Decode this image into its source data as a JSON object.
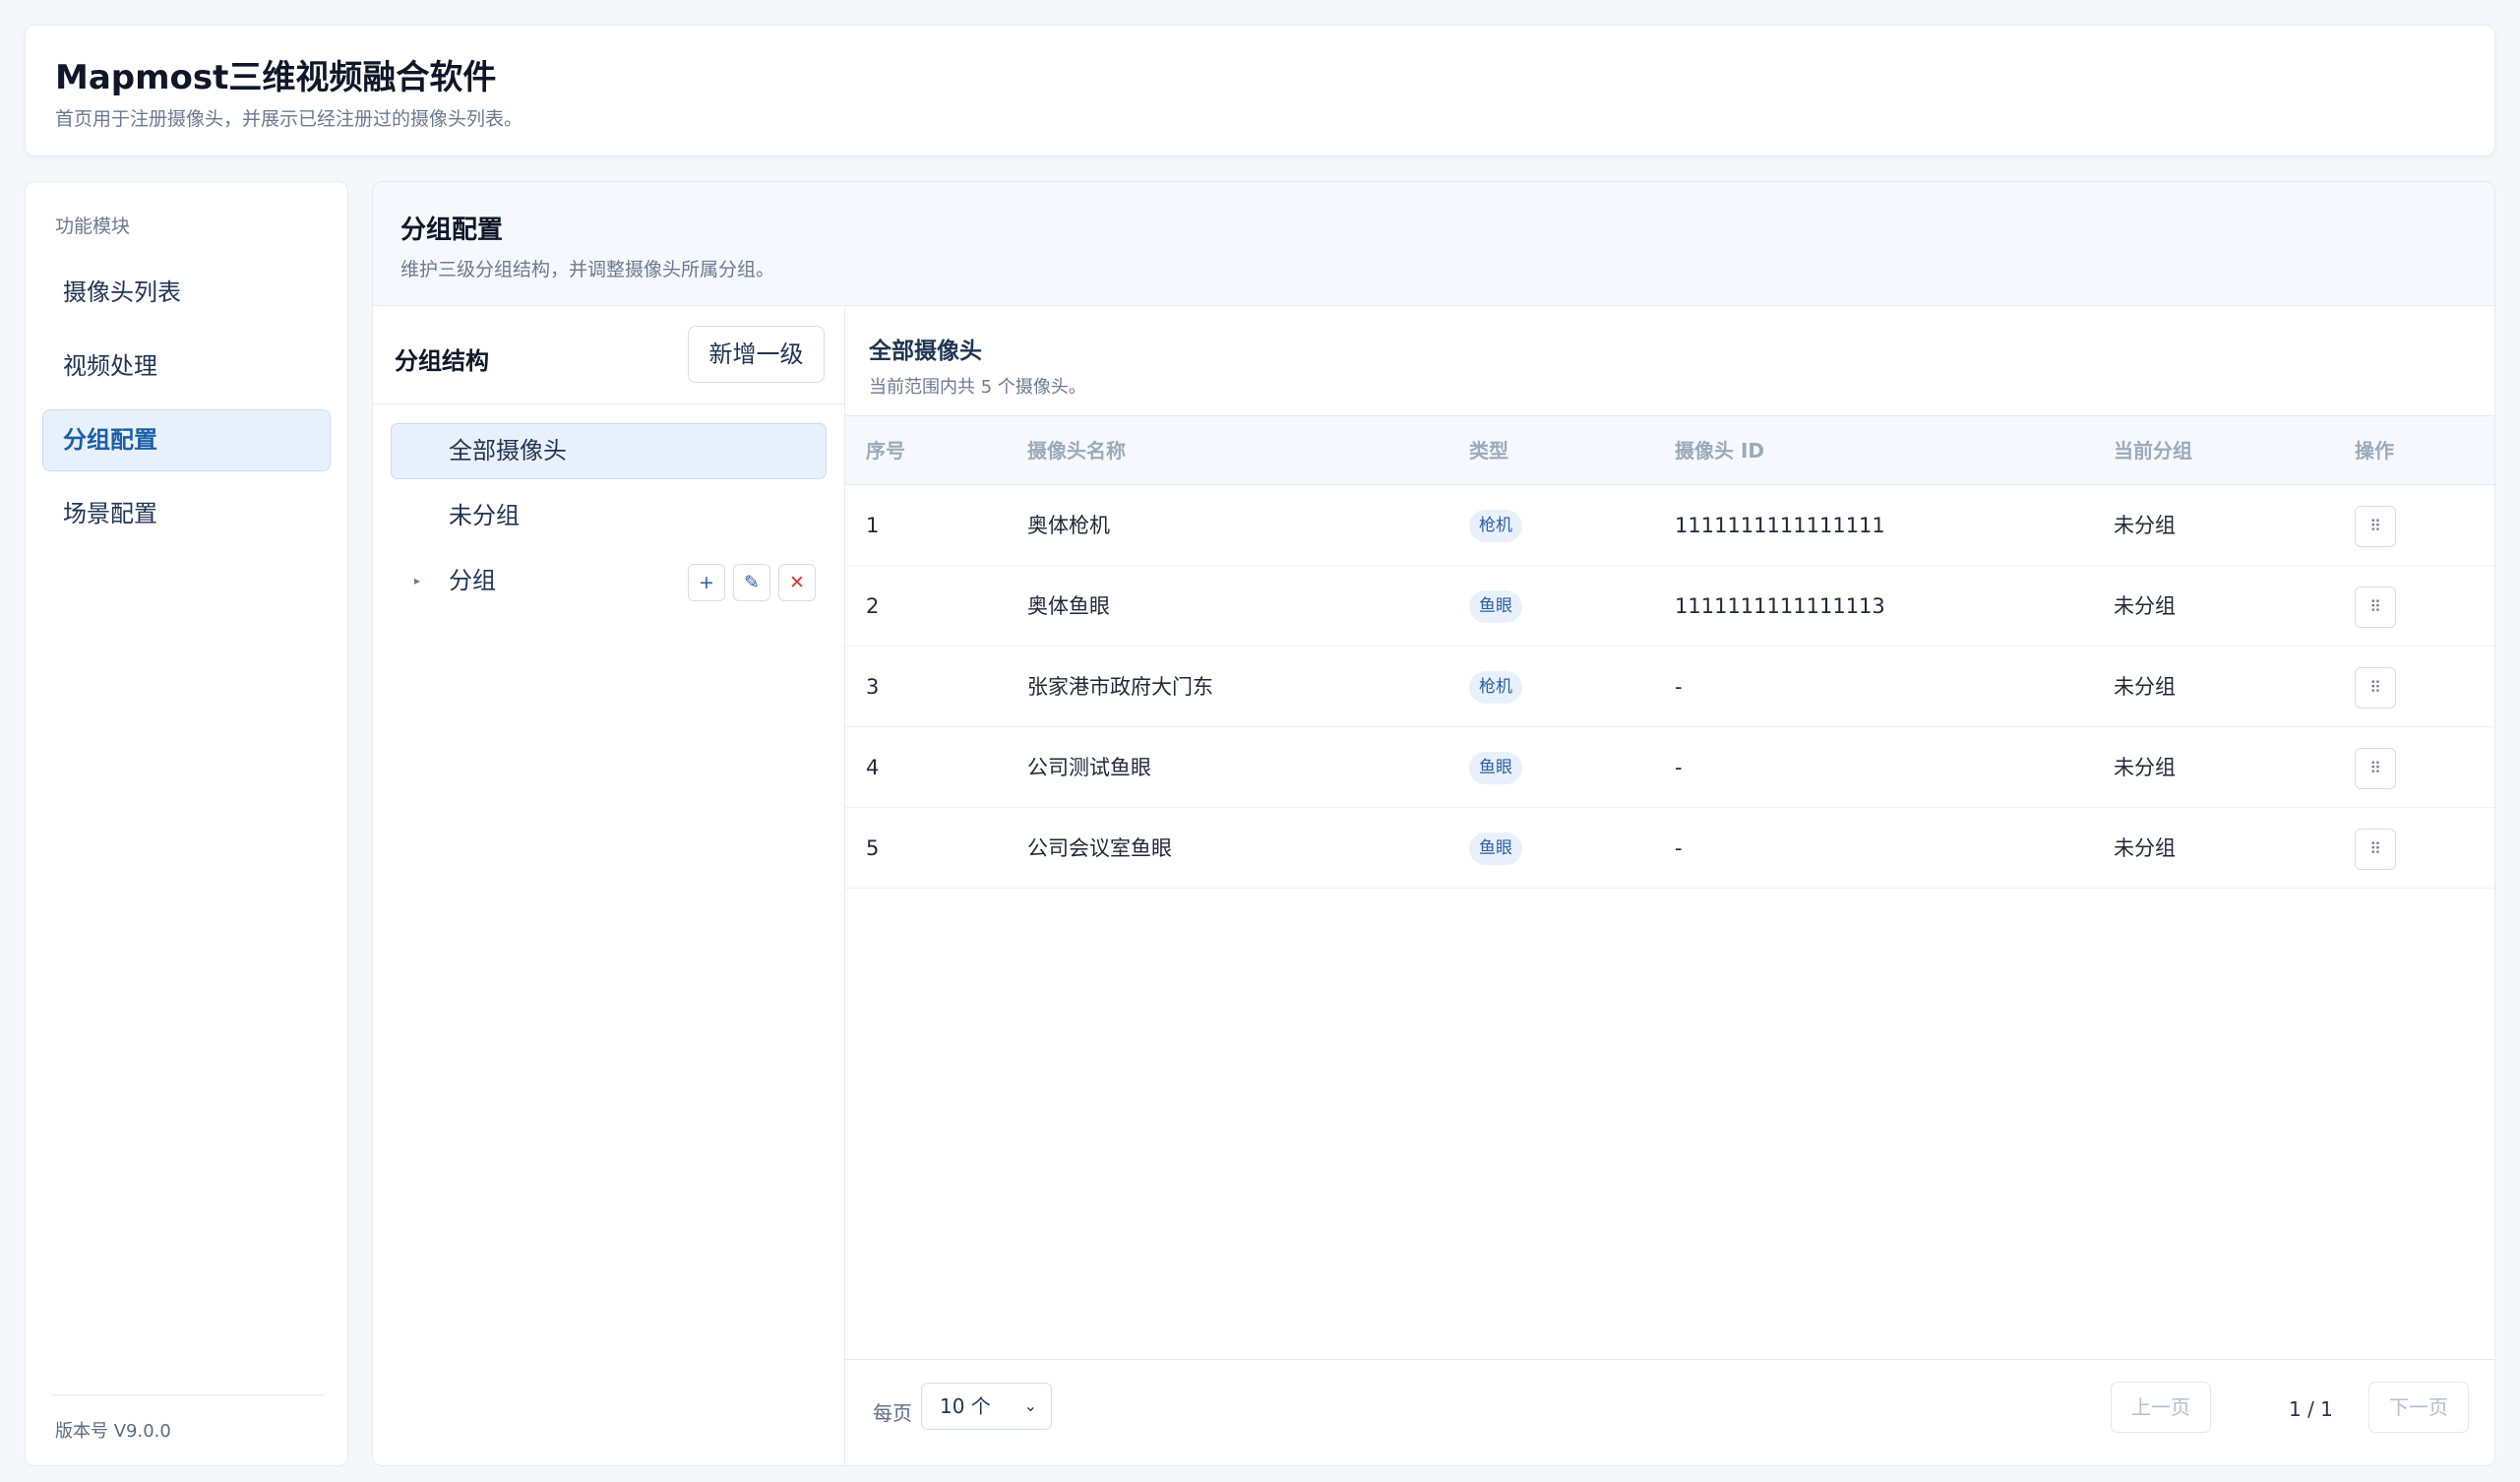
{
  "app": {
    "title": "Mapmost三维视频融合软件",
    "subtitle": "首页用于注册摄像头，并展示已经注册过的摄像头列表。"
  },
  "sidebar": {
    "section_label": "功能模块",
    "items": [
      {
        "label": "摄像头列表",
        "active": false
      },
      {
        "label": "视频处理",
        "active": false
      },
      {
        "label": "分组配置",
        "active": true
      },
      {
        "label": "场景配置",
        "active": false
      }
    ],
    "version": "版本号 V9.0.0"
  },
  "main": {
    "title": "分组配置",
    "subtitle": "维护三级分组结构，并调整摄像头所属分组。"
  },
  "group_pane": {
    "title": "分组结构",
    "add_button": "新增一级",
    "tree": [
      {
        "label": "全部摄像头",
        "active": true
      },
      {
        "label": "未分组",
        "active": false
      },
      {
        "label": "分组",
        "active": false,
        "collapsible": true,
        "caret": "▸",
        "actions": [
          "+",
          "✎",
          "✕"
        ]
      }
    ]
  },
  "camera_pane": {
    "title": "全部摄像头",
    "count_text": "当前范围内共 5 个摄像头。",
    "columns": [
      "序号",
      "摄像头名称",
      "类型",
      "摄像头 ID",
      "当前分组",
      "操作"
    ],
    "rows": [
      {
        "index": "1",
        "name": "奥体枪机",
        "type": "枪机",
        "id": "1111111111111111",
        "group": "未分组"
      },
      {
        "index": "2",
        "name": "奥体鱼眼",
        "type": "鱼眼",
        "id": "1111111111111113",
        "group": "未分组"
      },
      {
        "index": "3",
        "name": "张家港市政府大门东",
        "type": "枪机",
        "id": "-",
        "group": "未分组"
      },
      {
        "index": "4",
        "name": "公司测试鱼眼",
        "type": "鱼眼",
        "id": "-",
        "group": "未分组"
      },
      {
        "index": "5",
        "name": "公司会议室鱼眼",
        "type": "鱼眼",
        "id": "-",
        "group": "未分组"
      }
    ],
    "row_action_icon": "⠿"
  },
  "pager": {
    "per_page_label": "每页",
    "per_page_value": "10 个",
    "prev_label": "上一页",
    "page_info": "1 / 1",
    "next_label": "下一页"
  },
  "colors": {
    "accent": "#1b5fa8",
    "active_bg": "#e8f1fb",
    "danger": "#d33a3a"
  }
}
